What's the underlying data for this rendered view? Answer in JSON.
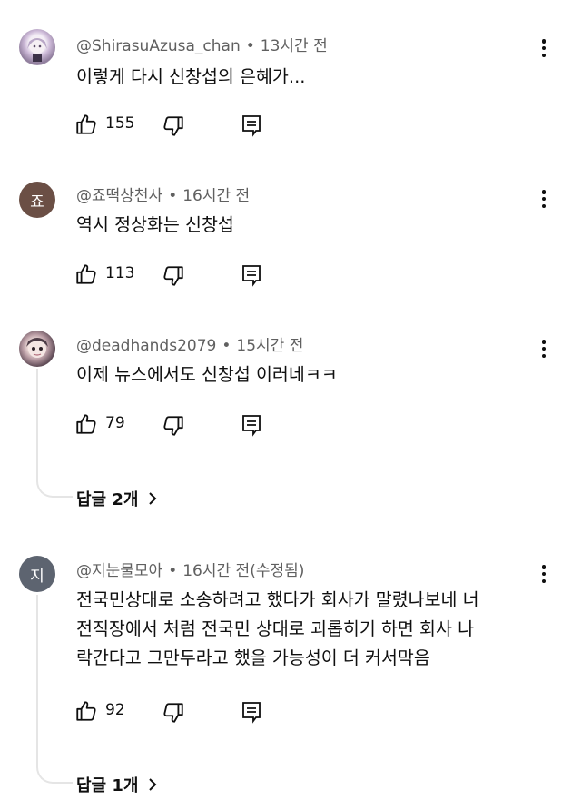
{
  "comments": [
    {
      "handle": "@ShirasuAzusa_chan",
      "time": "13시간 전",
      "text": "이렇게 다시 신창섭의 은혜가...",
      "likes": "155",
      "avatar_icon": "anime-avatar-image"
    },
    {
      "handle": "@죠떡상천사",
      "time": "16시간 전",
      "text": "역시 정상화는 신창섭",
      "likes": "113",
      "avatar_letter": "죠",
      "avatar_color": "#6b4f45"
    },
    {
      "handle": "@deadhands2079",
      "time": "15시간 전",
      "text": "이제 뉴스에서도 신창섭 이러네ㅋㅋ",
      "likes": "79",
      "avatar_icon": "anime-avatar-image",
      "replies": "답글 2개"
    },
    {
      "handle": "@지눈물모아",
      "time": "16시간 전(수정됨)",
      "text_lines": [
        "전국민상대로 소송하려고 했다가 회사가 말렸나보네 너",
        "전직장에서 처럼 전국민 상대로 괴롭히기 하면 회사 나",
        "락간다고 그만두라고 했을 가능성이 더 커서막음"
      ],
      "likes": "92",
      "avatar_letter": "지",
      "avatar_color": "#5d6470",
      "replies": "답글 1개"
    }
  ],
  "separator": "•"
}
